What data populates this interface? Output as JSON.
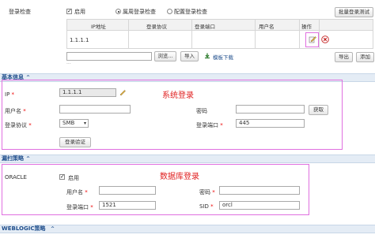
{
  "top": {
    "port_check_label": "登录检查",
    "enable_label": "启用",
    "radio_all_label": "属周登录检查",
    "radio_config_label": "配置登录检查",
    "batch_test_button": "批量登录测试",
    "ops_header": "操作"
  },
  "ip_table": {
    "headers": [
      "IP地址",
      "登录协议",
      "登录端口",
      "用户名"
    ],
    "rows": [
      [
        "1.1.1.1",
        "",
        "",
        ""
      ]
    ],
    "row_marker": "..."
  },
  "upload": {
    "browse_button": "浏览...",
    "import_button": "导入",
    "template_download": "模板下载",
    "export_button": "导出",
    "add_button": "添加"
  },
  "basic_section": {
    "title": "基本信息",
    "annotation": "系统登录",
    "ip_label": "IP",
    "ip_value": "1.1.1.1",
    "username_label": "用户名",
    "username_value": "",
    "password_label": "密码",
    "password_value": "",
    "fetch_button": "获取",
    "protocol_label": "登录协议",
    "protocol_value": "SMB",
    "port_label": "登录端口",
    "port_value": "445",
    "verify_button": "登录验证"
  },
  "db_section": {
    "title": "漏扫策略",
    "annotation": "数据库登录",
    "oracle_label": "ORACLE",
    "enable_label": "启用",
    "username_label": "用户名",
    "username_value": "",
    "password_label": "密码",
    "password_value": "",
    "port_label": "登录端口",
    "port_value": "1521",
    "sid_label": "SID",
    "sid_value": "orcl"
  },
  "weblogic_section": {
    "title": "WEBLOGIC策略"
  },
  "colors": {
    "section_header_bg": "#e4ecf5",
    "section_title": "#1f4e8c",
    "annotation_red": "#e02020",
    "highlight_border": "#e070e0"
  }
}
